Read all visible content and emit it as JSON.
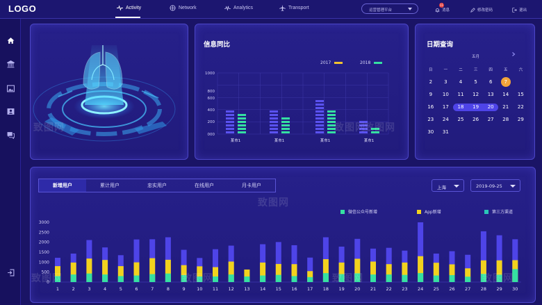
{
  "logo": "LOGO",
  "nav": [
    {
      "label": "Activity",
      "icon": "activity-icon",
      "active": true
    },
    {
      "label": "Network",
      "icon": "network-icon"
    },
    {
      "label": "Analytics",
      "icon": "analytics-icon"
    },
    {
      "label": "Transport",
      "icon": "transport-icon"
    }
  ],
  "platform_select": "运营管理平台",
  "top_links": {
    "messages": "消息",
    "message_count": "11",
    "change_password": "修改密码",
    "logout": "退出"
  },
  "watermark": "致图网",
  "sidebar_icons": [
    "home-icon",
    "bank-icon",
    "image-icon",
    "id-card-icon",
    "chat-icon",
    "logout-icon"
  ],
  "compare_panel": {
    "title": "信息同比",
    "legend": [
      {
        "name": "2017",
        "color": "#f2c230"
      },
      {
        "name": "2018",
        "color": "#35e0a2"
      }
    ]
  },
  "date_panel": {
    "title": "日期查询",
    "month": "五月",
    "weekdays": [
      "日",
      "一",
      "二",
      "三",
      "四",
      "五",
      "六"
    ],
    "weeks": [
      [
        "2",
        "3",
        "4",
        "5",
        "6",
        "7",
        ""
      ],
      [
        "9",
        "10",
        "11",
        "12",
        "13",
        "14",
        "15"
      ],
      [
        "16",
        "17",
        "18",
        "19",
        "20",
        "21",
        "22"
      ],
      [
        "23",
        "24",
        "25",
        "26",
        "27",
        "28",
        "29"
      ],
      [
        "30",
        "31",
        "",
        "",
        "",
        "",
        ""
      ]
    ],
    "today": "7",
    "range": [
      "18",
      "19",
      "20"
    ]
  },
  "tabs": [
    "新增用户",
    "累计用户",
    "忠实用户",
    "在线用户",
    "月卡用户"
  ],
  "filters": {
    "region": "上海",
    "date": "2019-09-25"
  },
  "colors": {
    "accent": "#4e44e8",
    "green": "#35e0a2",
    "yellow": "#f2d21e",
    "teal": "#2ac7b8"
  },
  "chart_data": [
    {
      "type": "bar",
      "categories": [
        "某市1",
        "某市1",
        "某市1",
        "某市1"
      ],
      "series": [
        {
          "name": "2017",
          "values": [
            440,
            440,
            580,
            230
          ]
        },
        {
          "name": "2018",
          "values": [
            380,
            310,
            400,
            170
          ]
        }
      ],
      "yticks": [
        "1000",
        "800",
        "600",
        "400",
        "200",
        "000"
      ],
      "ylim": [
        0,
        1000
      ]
    },
    {
      "type": "bar",
      "stacked": true,
      "categories": [
        "1",
        "2",
        "3",
        "4",
        "5",
        "6",
        "7",
        "8",
        "9",
        "10",
        "11",
        "12",
        "13",
        "14",
        "15",
        "16",
        "17",
        "18",
        "19",
        "20",
        "21",
        "22",
        "23",
        "24",
        "25",
        "26",
        "27",
        "28",
        "29",
        "30"
      ],
      "series": [
        {
          "name": "微信公众号新增",
          "color": "#35e0a2",
          "values": [
            300,
            380,
            430,
            380,
            300,
            330,
            400,
            430,
            350,
            280,
            280,
            380,
            280,
            330,
            360,
            300,
            250,
            450,
            400,
            440,
            380,
            380,
            360,
            450,
            330,
            350,
            270,
            410,
            370,
            650
          ]
        },
        {
          "name": "App新增",
          "color": "#f2d21e",
          "values": [
            500,
            600,
            750,
            730,
            500,
            660,
            800,
            690,
            500,
            510,
            470,
            650,
            350,
            650,
            550,
            600,
            300,
            700,
            580,
            730,
            650,
            520,
            620,
            850,
            640,
            540,
            420,
            680,
            720,
            450
          ]
        },
        {
          "name": "第三方渠道",
          "color": "#4e44e8",
          "values": [
            420,
            450,
            930,
            630,
            550,
            1150,
            950,
            1130,
            770,
            420,
            900,
            800,
            0,
            920,
            1100,
            950,
            680,
            1100,
            800,
            1000,
            650,
            820,
            600,
            1700,
            460,
            660,
            680,
            1460,
            1260,
            1050
          ]
        }
      ],
      "yticks": [
        "3000",
        "2500",
        "2000",
        "1500",
        "1000",
        "500",
        "0"
      ],
      "ylim": [
        0,
        3000
      ]
    }
  ]
}
